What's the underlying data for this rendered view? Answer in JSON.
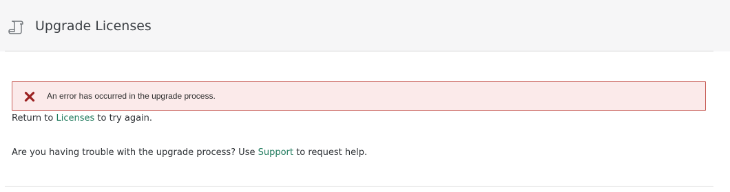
{
  "header": {
    "title": "Upgrade Licenses",
    "icon": "scroll-icon"
  },
  "alert": {
    "icon": "error-x-icon",
    "message": "An error has occurred in the upgrade process.",
    "colors": {
      "background": "#fbeaea",
      "border": "#c75d57",
      "icon": "#9b2222"
    }
  },
  "return_line": {
    "prefix": "Return to ",
    "link_label": "Licenses",
    "suffix": " to try again."
  },
  "help_line": {
    "prefix": "Are you having trouble with the upgrade process? Use ",
    "link_label": "Support",
    "suffix": " to request help."
  },
  "colors": {
    "link": "#1f7a5c",
    "header_background": "#f6f6f7"
  }
}
